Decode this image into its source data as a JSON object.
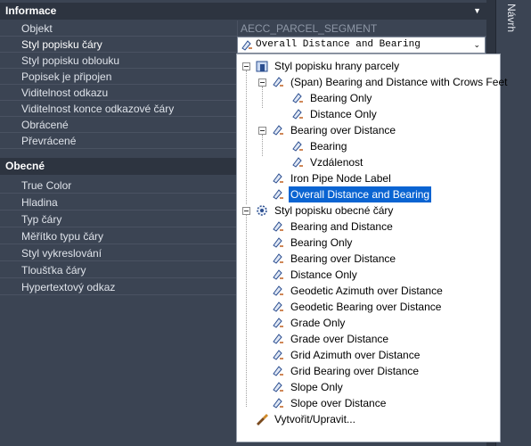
{
  "panel": {
    "sections": [
      {
        "title": "Informace"
      },
      {
        "title": "Obecné"
      }
    ],
    "info_rows": [
      {
        "label": "Objekt",
        "value": "AECC_PARCEL_SEGMENT"
      },
      {
        "label": "Styl popisku čáry",
        "value": ""
      },
      {
        "label": "Styl popisku oblouku",
        "value": ""
      },
      {
        "label": "Popisek je připojen",
        "value": ""
      },
      {
        "label": "Viditelnost odkazu",
        "value": ""
      },
      {
        "label": "Viditelnost konce odkazové čáry",
        "value": ""
      },
      {
        "label": "Obrácené",
        "value": ""
      },
      {
        "label": "Převrácené",
        "value": ""
      }
    ],
    "general_rows": [
      {
        "label": "True Color"
      },
      {
        "label": "Hladina"
      },
      {
        "label": "Typ čáry"
      },
      {
        "label": "Měřítko typu čáry"
      },
      {
        "label": "Styl vykreslování"
      },
      {
        "label": "Tloušťka čáry"
      },
      {
        "label": "Hypertextový odkaz"
      }
    ],
    "selected_style": "Overall Distance and Bearing"
  },
  "side_tab": {
    "label": "Návrh"
  },
  "dropdown": {
    "root1": "Styl popisku hrany parcely",
    "span_group": "(Span)  Bearing and Distance with Crows Feet",
    "span_children": [
      "Bearing Only",
      "Distance Only"
    ],
    "bod_group": "Bearing over Distance",
    "bod_children": [
      "Bearing",
      "Vzdálenost"
    ],
    "iron_pipe": "Iron Pipe Node Label",
    "overall": "Overall Distance and Bearing",
    "root2": "Styl popisku obecné čáry",
    "general_items": [
      "Bearing and Distance",
      "Bearing Only",
      "Bearing over Distance",
      "Distance Only",
      "Geodetic Azimuth over Distance",
      "Geodetic Bearing over Distance",
      "Grade Only",
      "Grade over Distance",
      "Grid Azimuth over Distance",
      "Grid Bearing over Distance",
      "Slope Only",
      "Slope over Distance"
    ],
    "create_edit": "Vytvořit/Upravit..."
  },
  "icons": {
    "collapse": "triangle-down-icon",
    "label_style": "label-style-icon",
    "folder_style": "style-folder-icon",
    "gear_style": "gear-style-icon",
    "create_edit": "create-edit-icon"
  },
  "colors": {
    "panel_bg": "#3b4453",
    "header_bg": "#2d3440",
    "highlight": "#0a64d2"
  }
}
